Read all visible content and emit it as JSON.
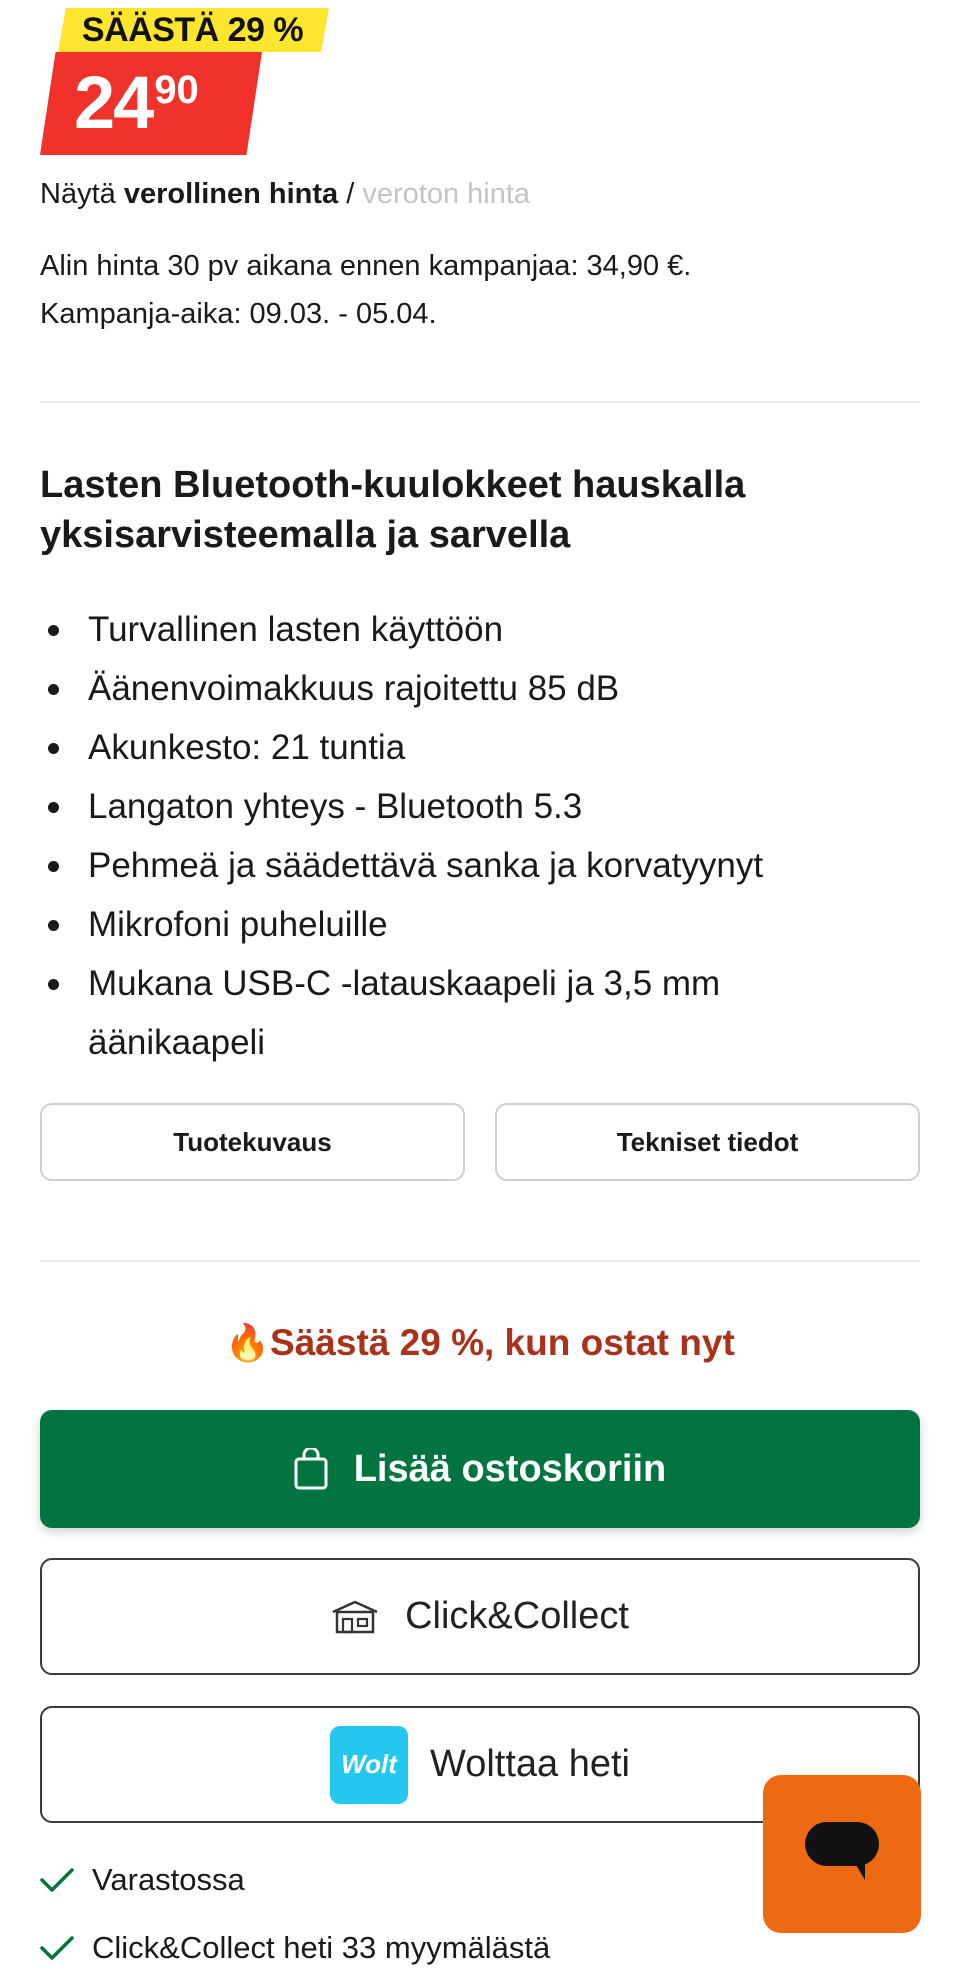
{
  "price": {
    "badge": "SÄÄSTÄ 29 %",
    "integer": "24",
    "decimals": "90"
  },
  "tax_toggle": {
    "prefix": "Näytä",
    "with_tax": "verollinen hinta",
    "separator": "/",
    "without_tax": "veroton hinta"
  },
  "campaign": {
    "lowest_price": "Alin hinta 30 pv aikana ennen kampanjaa: 34,90 €.",
    "period": "Kampanja-aika: 09.03. - 05.04."
  },
  "product": {
    "title": "Lasten Bluetooth-kuulokkeet hauskalla yksisarvisteemalla ja sarvella",
    "features": [
      "Turvallinen lasten käyttöön",
      "Äänenvoimakkuus rajoitettu 85 dB",
      "Akunkesto: 21 tuntia",
      "Langaton yhteys - Bluetooth 5.3",
      "Pehmeä ja säädettävä sanka ja korvatyynyt",
      "Mikrofoni puheluille",
      "Mukana USB-C -latauskaapeli ja 3,5 mm äänikaapeli"
    ]
  },
  "tabs": {
    "description": "Tuotekuvaus",
    "specs": "Tekniset tiedot"
  },
  "promo": {
    "icon": "fire-icon",
    "text": "Säästä 29 %, kun ostat nyt"
  },
  "actions": {
    "add_to_cart": "Lisää ostoskoriin",
    "click_collect": "Click&Collect",
    "wolt_logo": "Wolt",
    "wolt": "Wolttaa heti"
  },
  "availability": {
    "in_stock": "Varastossa",
    "click_collect": "Click&Collect heti 33 myymälästä"
  },
  "colors": {
    "badge_yellow": "#ffe62e",
    "price_red": "#f0322a",
    "primary_green": "#017440",
    "promo_red": "#a8321a",
    "wolt_blue": "#24c7ef",
    "chat_orange": "#ee6a12",
    "check_green": "#017440"
  }
}
